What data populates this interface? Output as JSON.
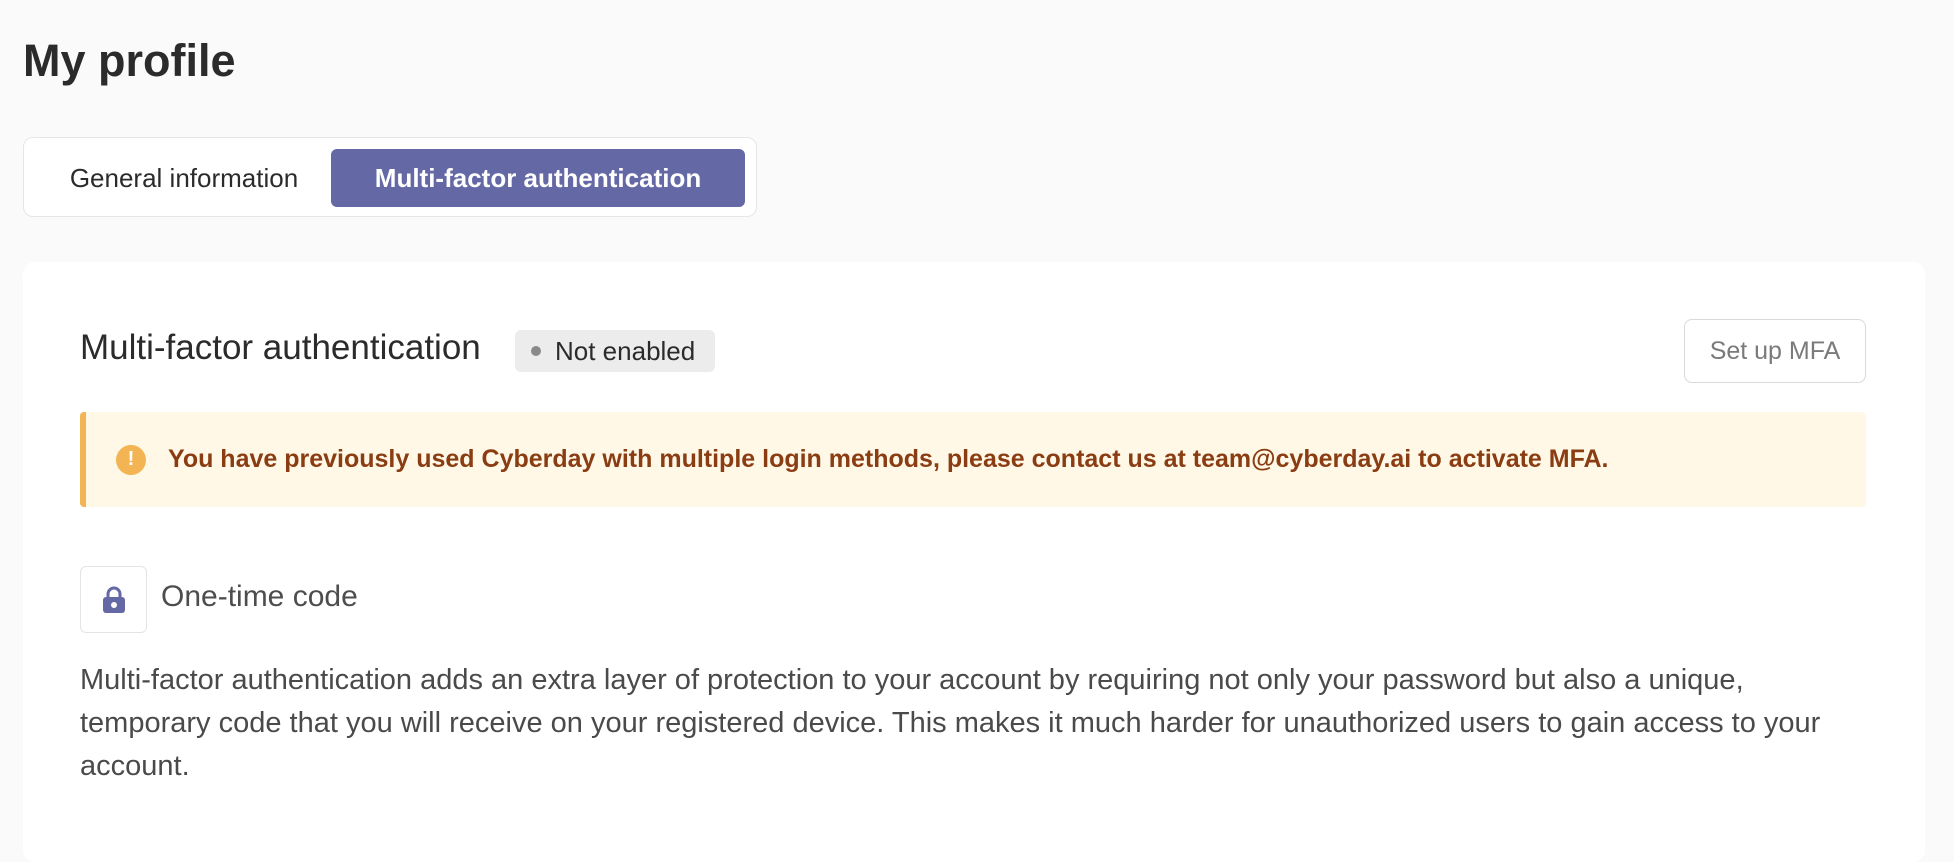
{
  "page": {
    "title": "My profile"
  },
  "tabs": [
    {
      "label": "General information",
      "active": false
    },
    {
      "label": "Multi-factor authentication",
      "active": true
    }
  ],
  "mfa": {
    "title": "Multi-factor authentication",
    "status_badge": "Not enabled",
    "setup_button": "Set up MFA",
    "alert": {
      "icon": "!",
      "text": "You have previously used Cyberday with multiple login methods, please contact us at team@cyberday.ai to activate MFA."
    },
    "method": {
      "icon": "lock-icon",
      "label": "One-time code"
    },
    "description": "Multi-factor authentication adds an extra layer of protection to your account by requiring not only your password but also a unique, temporary code that you will receive on your registered device. This makes it much harder for unauthorized users to gain access to your account."
  },
  "colors": {
    "accent": "#6468a5",
    "warning_border": "#f3b554",
    "warning_bg": "#fff8e6",
    "warning_text": "#8a3c12"
  }
}
